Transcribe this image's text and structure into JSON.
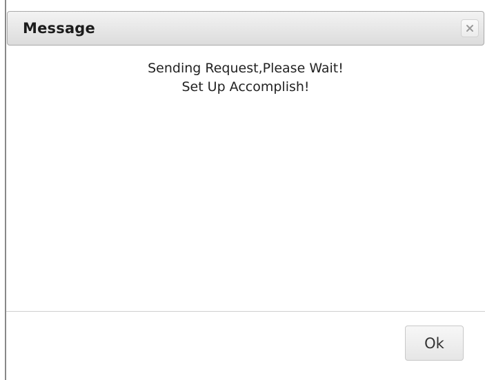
{
  "dialog": {
    "title": "Message",
    "close_icon": "close-icon",
    "messages": [
      "Sending Request,Please Wait!",
      "Set Up Accomplish!"
    ],
    "ok_label": "Ok"
  },
  "colors": {
    "titlebar_top": "#f3f3f3",
    "titlebar_bottom": "#dcdcdc",
    "text": "#222222",
    "divider": "#cfcfcf"
  }
}
